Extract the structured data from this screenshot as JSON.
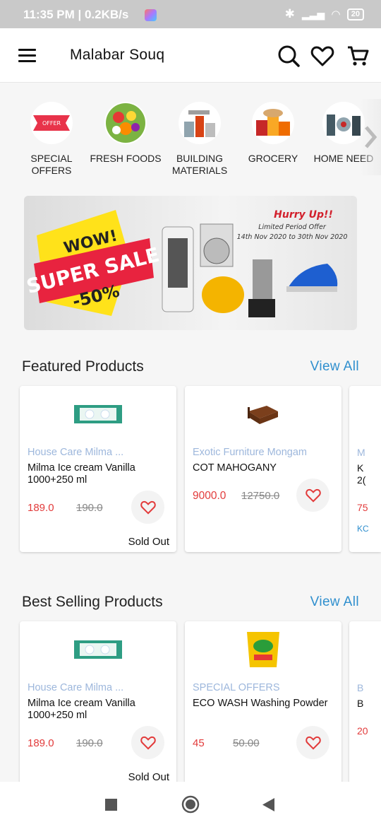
{
  "status_bar": {
    "time": "11:35 PM | 0.2KB/s",
    "battery": "20"
  },
  "header": {
    "title": "Malabar Souq"
  },
  "categories": [
    {
      "label": "SPECIAL OFFERS",
      "badge": "OFFER"
    },
    {
      "label": "FRESH FOODS"
    },
    {
      "label": "BUILDING MATERIALS"
    },
    {
      "label": "GROCERY"
    },
    {
      "label": "HOME NEED"
    }
  ],
  "banner": {
    "wow": "WOW!",
    "super_sale": "SUPER SALE",
    "discount": "-50%",
    "hurry": "Hurry Up!!",
    "limited": "Limited Period Offer",
    "dates": "14th Nov 2020  to  30th Nov 2020"
  },
  "featured": {
    "title": "Featured Products",
    "view_all": "View All",
    "products": [
      {
        "brand": "House Care Milma ...",
        "name": "Milma Ice cream  Vanilla 1000+250 ml",
        "price": "189.0",
        "old_price": "190.0",
        "status": "Sold Out"
      },
      {
        "brand": "Exotic Furniture Mongam",
        "name": "COT MAHOGANY",
        "price": "9000.0",
        "old_price": "12750.0",
        "status": ""
      }
    ],
    "peek": {
      "brand": "M",
      "name": "K",
      "name2": "2(",
      "price": "75",
      "extra": "KC"
    }
  },
  "best_selling": {
    "title": "Best Selling Products",
    "view_all": "View All",
    "products": [
      {
        "brand": "House Care Milma ...",
        "name": "Milma Ice cream  Vanilla 1000+250 ml",
        "price": "189.0",
        "old_price": "190.0",
        "status": "Sold Out"
      },
      {
        "brand": "SPECIAL OFFERS",
        "name": "ECO WASH Washing Powder",
        "price": "45",
        "old_price": "50.00",
        "status": ""
      }
    ],
    "peek": {
      "brand": "B",
      "name": "B",
      "price": "20"
    }
  },
  "colors": {
    "accent": "#2f8fce",
    "price": "#e23b3b",
    "brand": "#9db7dc"
  }
}
